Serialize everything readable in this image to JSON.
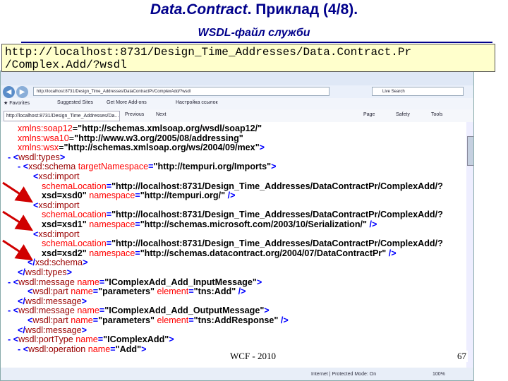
{
  "slide": {
    "title_italic": "Data.Contract",
    "title_rest": ". Приклад  (4/8).",
    "subtitle": "WSDL-файл служби",
    "url_line1": "http://localhost:8731/Design_Time_Addresses/Data.Contract.Pr",
    "url_line2": "/Complex.Add/?wsdl",
    "footer": "WCF  - 2010",
    "page_number": "67"
  },
  "browser": {
    "address": "http://localhost:8731/Design_Time_Addresses/DataContractPr/ComplexAdd/?wsdl",
    "search_placeholder": "Live Search",
    "favorites_label": "Favorites",
    "favbar_items": [
      "Suggested Sites",
      "Get More Add-ons",
      "Настройка ссылок"
    ],
    "tab_label": "http://localhost:8731/Design_Time_Addresses/Da...",
    "menu_items": [
      "Page",
      "Safety",
      "Tools"
    ],
    "find_prev": "Previous",
    "find_next": "Next",
    "status_text": "Internet | Protected Mode: On",
    "zoom": "100%",
    "lines": [
      {
        "x": 24,
        "parts": [
          [
            "a",
            "xmlns:soap12"
          ],
          [
            "n",
            "="
          ],
          [
            "v",
            "\"http://schemas.xmlsoap.org/wsdl/soap12/\""
          ]
        ]
      },
      {
        "x": 24,
        "parts": [
          [
            "a",
            "xmlns:wsa10"
          ],
          [
            "n",
            "="
          ],
          [
            "v",
            "\"http://www.w3.org/2005/08/addressing\""
          ]
        ]
      },
      {
        "x": 24,
        "parts": [
          [
            "a",
            "xmlns:wsx"
          ],
          [
            "n",
            "="
          ],
          [
            "v",
            "\"http://schemas.xmlsoap.org/ws/2004/09/mex\""
          ],
          [
            "m",
            ">"
          ]
        ]
      },
      {
        "x": 10,
        "parts": [
          [
            "m",
            "- <"
          ],
          [
            "t",
            "wsdl:types"
          ],
          [
            "m",
            ">"
          ]
        ]
      },
      {
        "x": 24,
        "parts": [
          [
            "m",
            "- <"
          ],
          [
            "t",
            "xsd:schema"
          ],
          [
            "a",
            " targetNamespace"
          ],
          [
            "m",
            "="
          ],
          [
            "v",
            "\"http://tempuri.org/Imports\""
          ],
          [
            "m",
            ">"
          ]
        ]
      },
      {
        "x": 46,
        "parts": [
          [
            "m",
            "<"
          ],
          [
            "t",
            "xsd:import"
          ]
        ]
      },
      {
        "x": 58,
        "parts": [
          [
            "a",
            "schemaLocation"
          ],
          [
            "m",
            "="
          ],
          [
            "v",
            "\"http://localhost:8731/Design_Time_Addresses/DataContractPr/ComplexAdd/?"
          ]
        ]
      },
      {
        "x": 58,
        "parts": [
          [
            "v",
            "xsd=xsd0\""
          ],
          [
            "a",
            " namespace"
          ],
          [
            "m",
            "="
          ],
          [
            "v",
            "\"http://tempuri.org/\""
          ],
          [
            "m",
            " />"
          ]
        ]
      },
      {
        "x": 46,
        "parts": [
          [
            "m",
            "<"
          ],
          [
            "t",
            "xsd:import"
          ]
        ]
      },
      {
        "x": 58,
        "parts": [
          [
            "a",
            "schemaLocation"
          ],
          [
            "m",
            "="
          ],
          [
            "v",
            "\"http://localhost:8731/Design_Time_Addresses/DataContractPr/ComplexAdd/?"
          ]
        ]
      },
      {
        "x": 58,
        "parts": [
          [
            "v",
            "xsd=xsd1\""
          ],
          [
            "a",
            " namespace"
          ],
          [
            "m",
            "="
          ],
          [
            "v",
            "\"http://schemas.microsoft.com/2003/10/Serialization/\""
          ],
          [
            "m",
            " />"
          ]
        ]
      },
      {
        "x": 46,
        "parts": [
          [
            "m",
            "<"
          ],
          [
            "t",
            "xsd:import"
          ]
        ]
      },
      {
        "x": 58,
        "parts": [
          [
            "a",
            "schemaLocation"
          ],
          [
            "m",
            "="
          ],
          [
            "v",
            "\"http://localhost:8731/Design_Time_Addresses/DataContractPr/ComplexAdd/?"
          ]
        ]
      },
      {
        "x": 58,
        "parts": [
          [
            "v",
            "xsd=xsd2\""
          ],
          [
            "a",
            " namespace"
          ],
          [
            "m",
            "="
          ],
          [
            "v",
            "\"http://schemas.datacontract.org/2004/07/DataContractPr\""
          ],
          [
            "m",
            " />"
          ]
        ]
      },
      {
        "x": 38,
        "parts": [
          [
            "m",
            "</"
          ],
          [
            "t",
            "xsd:schema"
          ],
          [
            "m",
            ">"
          ]
        ]
      },
      {
        "x": 24,
        "parts": [
          [
            "m",
            "</"
          ],
          [
            "t",
            "wsdl:types"
          ],
          [
            "m",
            ">"
          ]
        ]
      },
      {
        "x": 10,
        "parts": [
          [
            "m",
            "- <"
          ],
          [
            "t",
            "wsdl:message"
          ],
          [
            "a",
            " name"
          ],
          [
            "m",
            "="
          ],
          [
            "v",
            "\"IComplexAdd_Add_InputMessage\""
          ],
          [
            "m",
            ">"
          ]
        ]
      },
      {
        "x": 38,
        "parts": [
          [
            "m",
            "<"
          ],
          [
            "t",
            "wsdl:part"
          ],
          [
            "a",
            " name"
          ],
          [
            "m",
            "="
          ],
          [
            "v",
            "\"parameters\""
          ],
          [
            "a",
            " element"
          ],
          [
            "m",
            "="
          ],
          [
            "v",
            "\"tns:Add\""
          ],
          [
            "m",
            " />"
          ]
        ]
      },
      {
        "x": 24,
        "parts": [
          [
            "m",
            "</"
          ],
          [
            "t",
            "wsdl:message"
          ],
          [
            "m",
            ">"
          ]
        ]
      },
      {
        "x": 10,
        "parts": [
          [
            "m",
            "- <"
          ],
          [
            "t",
            "wsdl:message"
          ],
          [
            "a",
            " name"
          ],
          [
            "m",
            "="
          ],
          [
            "v",
            "\"IComplexAdd_Add_OutputMessage\""
          ],
          [
            "m",
            ">"
          ]
        ]
      },
      {
        "x": 38,
        "parts": [
          [
            "m",
            "<"
          ],
          [
            "t",
            "wsdl:part"
          ],
          [
            "a",
            " name"
          ],
          [
            "m",
            "="
          ],
          [
            "v",
            "\"parameters\""
          ],
          [
            "a",
            " element"
          ],
          [
            "m",
            "="
          ],
          [
            "v",
            "\"tns:AddResponse\""
          ],
          [
            "m",
            " />"
          ]
        ]
      },
      {
        "x": 24,
        "parts": [
          [
            "m",
            "</"
          ],
          [
            "t",
            "wsdl:message"
          ],
          [
            "m",
            ">"
          ]
        ]
      },
      {
        "x": 10,
        "parts": [
          [
            "m",
            "- <"
          ],
          [
            "t",
            "wsdl:portType"
          ],
          [
            "a",
            " name"
          ],
          [
            "m",
            "="
          ],
          [
            "v",
            "\"IComplexAdd\""
          ],
          [
            "m",
            ">"
          ]
        ]
      },
      {
        "x": 24,
        "parts": [
          [
            "m",
            "- <"
          ],
          [
            "t",
            "wsdl:operation"
          ],
          [
            "a",
            " name"
          ],
          [
            "m",
            "="
          ],
          [
            "v",
            "\"Add\""
          ],
          [
            "m",
            ">"
          ]
        ]
      }
    ]
  }
}
